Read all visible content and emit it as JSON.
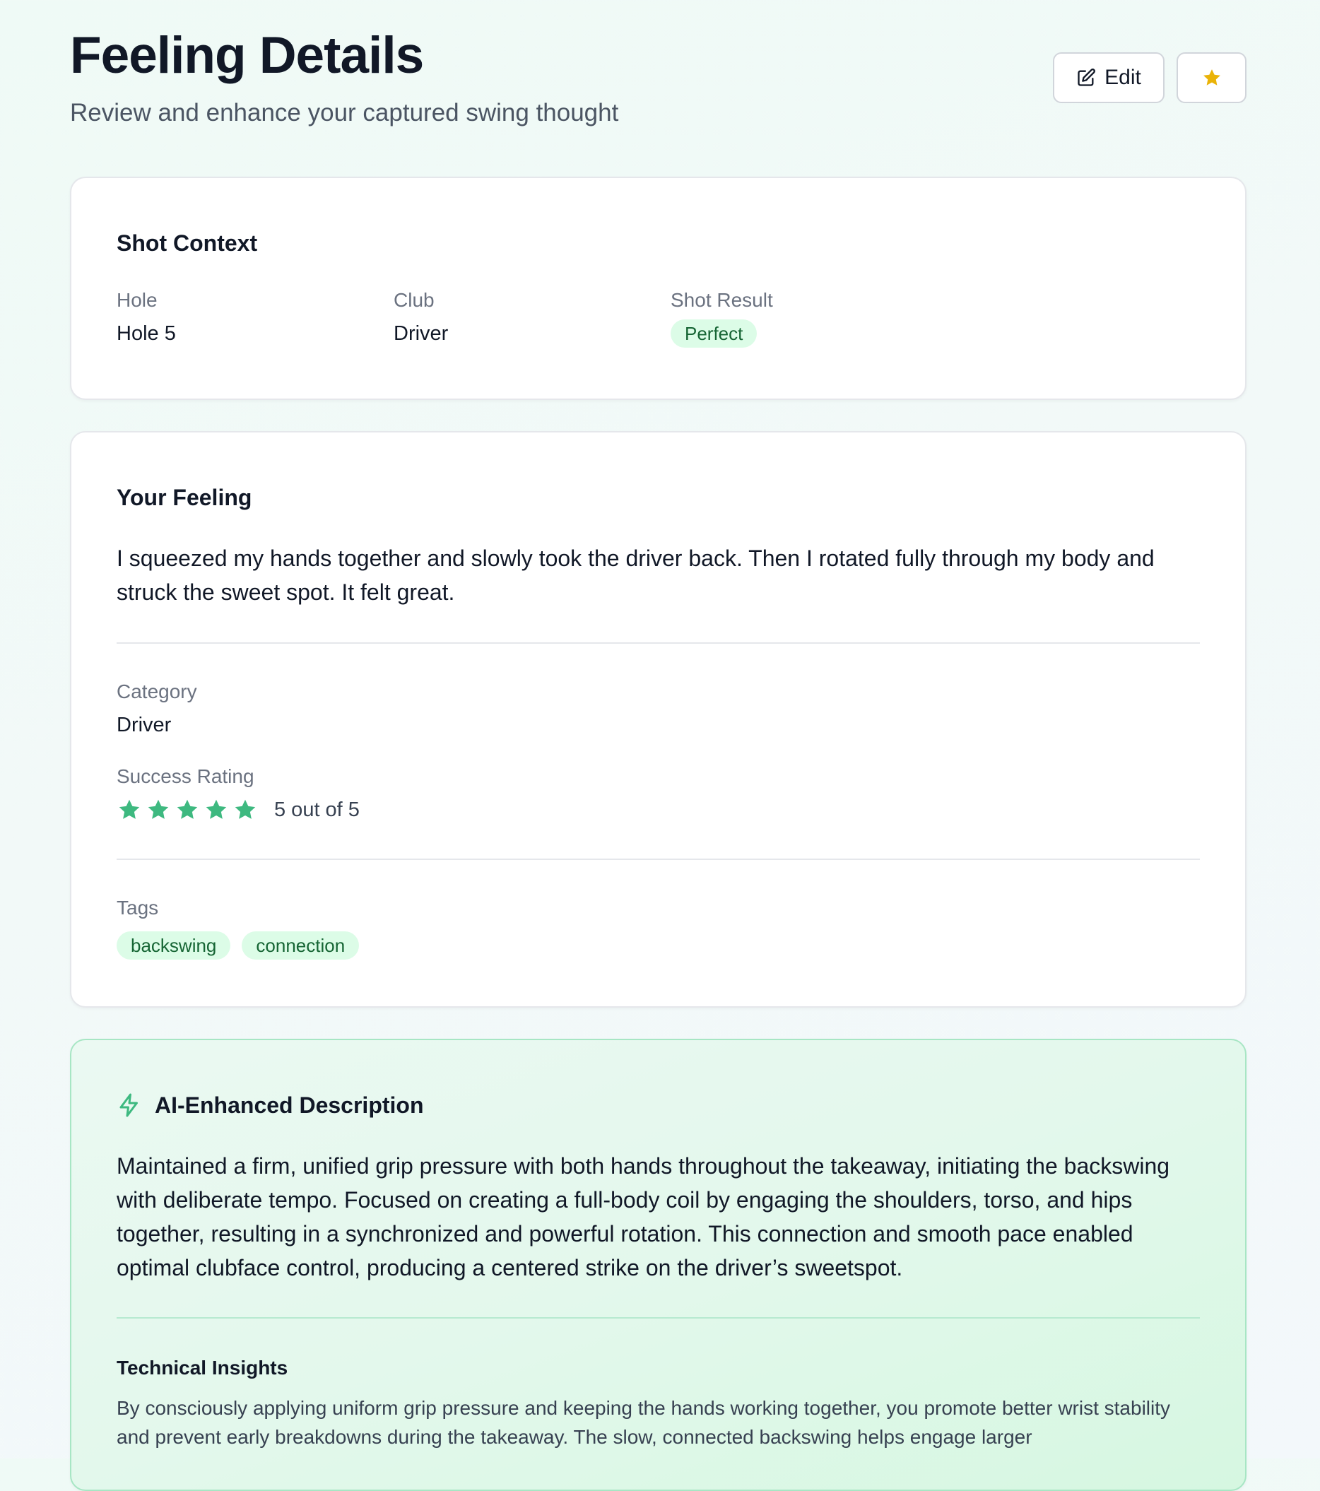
{
  "header": {
    "title": "Feeling Details",
    "subtitle": "Review and enhance your captured swing thought",
    "edit_label": "Edit"
  },
  "colors": {
    "accent_green": "#3eb980",
    "star_gold": "#eab308",
    "pill_bg": "#dcfce7",
    "pill_text": "#166534"
  },
  "icons": {
    "edit": "edit-icon",
    "favorite": "star-icon",
    "ai": "bolt-icon",
    "rating": "star-icon"
  },
  "shot_context": {
    "title": "Shot Context",
    "hole_label": "Hole",
    "hole_value": "Hole 5",
    "club_label": "Club",
    "club_value": "Driver",
    "result_label": "Shot Result",
    "result_value": "Perfect"
  },
  "feeling": {
    "title": "Your Feeling",
    "text": "I squeezed my hands together and slowly took the driver back. Then I rotated fully through my body and struck the sweet spot. It felt great.",
    "category_label": "Category",
    "category_value": "Driver",
    "rating_label": "Success Rating",
    "rating_value": 5,
    "rating_max": 5,
    "rating_text": "5 out of 5",
    "tags_label": "Tags",
    "tags": [
      "backswing",
      "connection"
    ]
  },
  "ai": {
    "title": "AI-Enhanced Description",
    "text": "Maintained a firm, unified grip pressure with both hands throughout the takeaway, initiating the backswing with deliberate tempo. Focused on creating a full-body coil by engaging the shoulders, torso, and hips together, resulting in a synchronized and powerful rotation. This connection and smooth pace enabled optimal clubface control, producing a centered strike on the driver’s sweetspot.",
    "insights_title": "Technical Insights",
    "insights_text": "By consciously applying uniform grip pressure and keeping the hands working together, you promote better wrist stability and prevent early breakdowns during the takeaway. The slow, connected backswing helps engage larger"
  }
}
